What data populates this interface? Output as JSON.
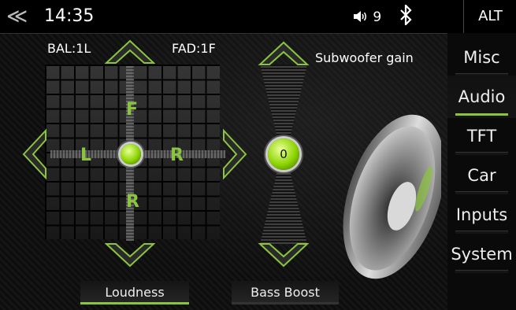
{
  "status_bar": {
    "back_icon": "double-chevron-left-icon",
    "time": "14:35",
    "volume_icon": "speaker-volume-icon",
    "volume_level": "9",
    "bluetooth_icon": "bluetooth-icon",
    "alt_label": "ALT"
  },
  "menu": {
    "items": [
      {
        "label": "Misc",
        "active": false
      },
      {
        "label": "Audio",
        "active": true
      },
      {
        "label": "TFT",
        "active": false
      },
      {
        "label": "Car",
        "active": false
      },
      {
        "label": "Inputs",
        "active": false
      },
      {
        "label": "System",
        "active": false
      }
    ]
  },
  "balance_fader": {
    "bal_label": "BAL:1L",
    "fad_label": "FAD:1F",
    "front_letter": "F",
    "rear_letter": "R",
    "left_letter": "L",
    "right_letter": "R"
  },
  "subwoofer": {
    "label": "Subwoofer gain",
    "value": "0"
  },
  "buttons": {
    "loudness": "Loudness",
    "bass_boost": "Bass Boost"
  },
  "colors": {
    "accent": "#8bc53f",
    "background": "#000000"
  }
}
